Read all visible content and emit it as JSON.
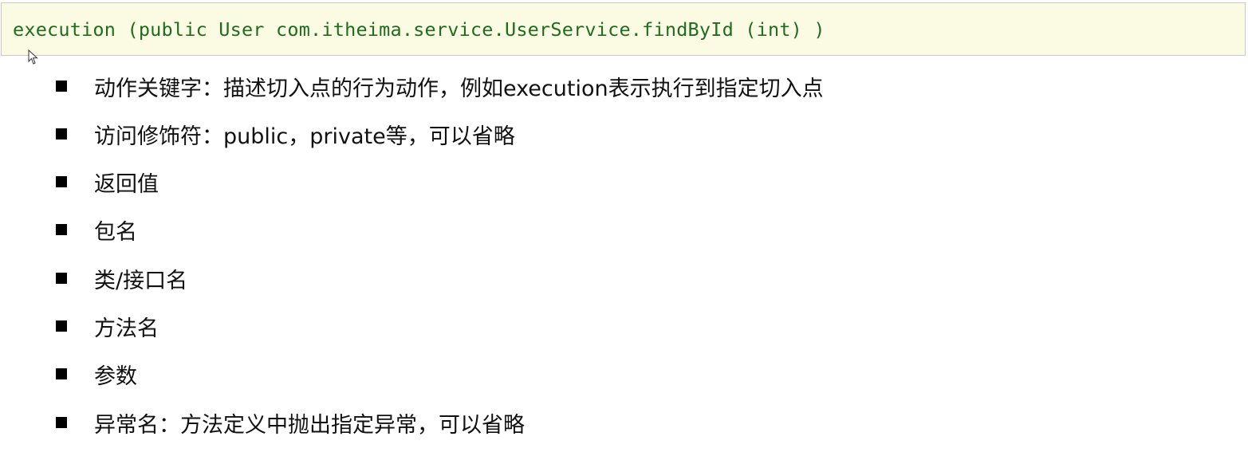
{
  "code": {
    "text": "execution (public User com.itheima.service.UserService.findById (int) )"
  },
  "cursor_icon": "mouse-pointer-icon",
  "bullets": [
    "动作关键字：描述切入点的行为动作，例如execution表示执行到指定切入点",
    "访问修饰符：public，private等，可以省略",
    "返回值",
    "包名",
    "类/接口名",
    "方法名",
    "参数",
    "异常名：方法定义中抛出指定异常，可以省略"
  ],
  "colors": {
    "code_background": "#fbfbe4",
    "code_text": "#1f6b1f",
    "code_border": "#c9c9c9",
    "bullet": "#000000",
    "text": "#111111"
  }
}
